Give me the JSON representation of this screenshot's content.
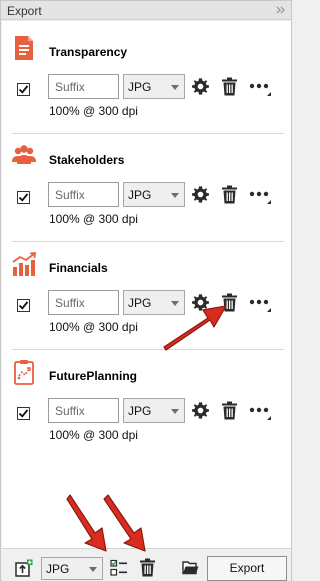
{
  "panel": {
    "title": "Export",
    "collapse_icon": "double-chevron-right-icon"
  },
  "sections": [
    {
      "title": "Transparency",
      "icon": "document-icon",
      "suffix_placeholder": "Suffix",
      "format": "JPG",
      "checked": true,
      "resolution": "100% @ 300 dpi"
    },
    {
      "title": "Stakeholders",
      "icon": "people-icon",
      "suffix_placeholder": "Suffix",
      "format": "JPG",
      "checked": true,
      "resolution": "100% @ 300 dpi"
    },
    {
      "title": "Financials",
      "icon": "bar-chart-icon",
      "suffix_placeholder": "Suffix",
      "format": "JPG",
      "checked": true,
      "resolution": "100% @ 300 dpi"
    },
    {
      "title": "FuturePlanning",
      "icon": "clipboard-icon",
      "suffix_placeholder": "Suffix",
      "format": "JPG",
      "checked": true,
      "resolution": "100% @ 300 dpi"
    }
  ],
  "footer": {
    "format": "JPG",
    "export_label": "Export"
  },
  "colors": {
    "accent": "#e8613e",
    "annotation_arrow": "#d92b1e",
    "icon_dark": "#2b2b2b"
  }
}
